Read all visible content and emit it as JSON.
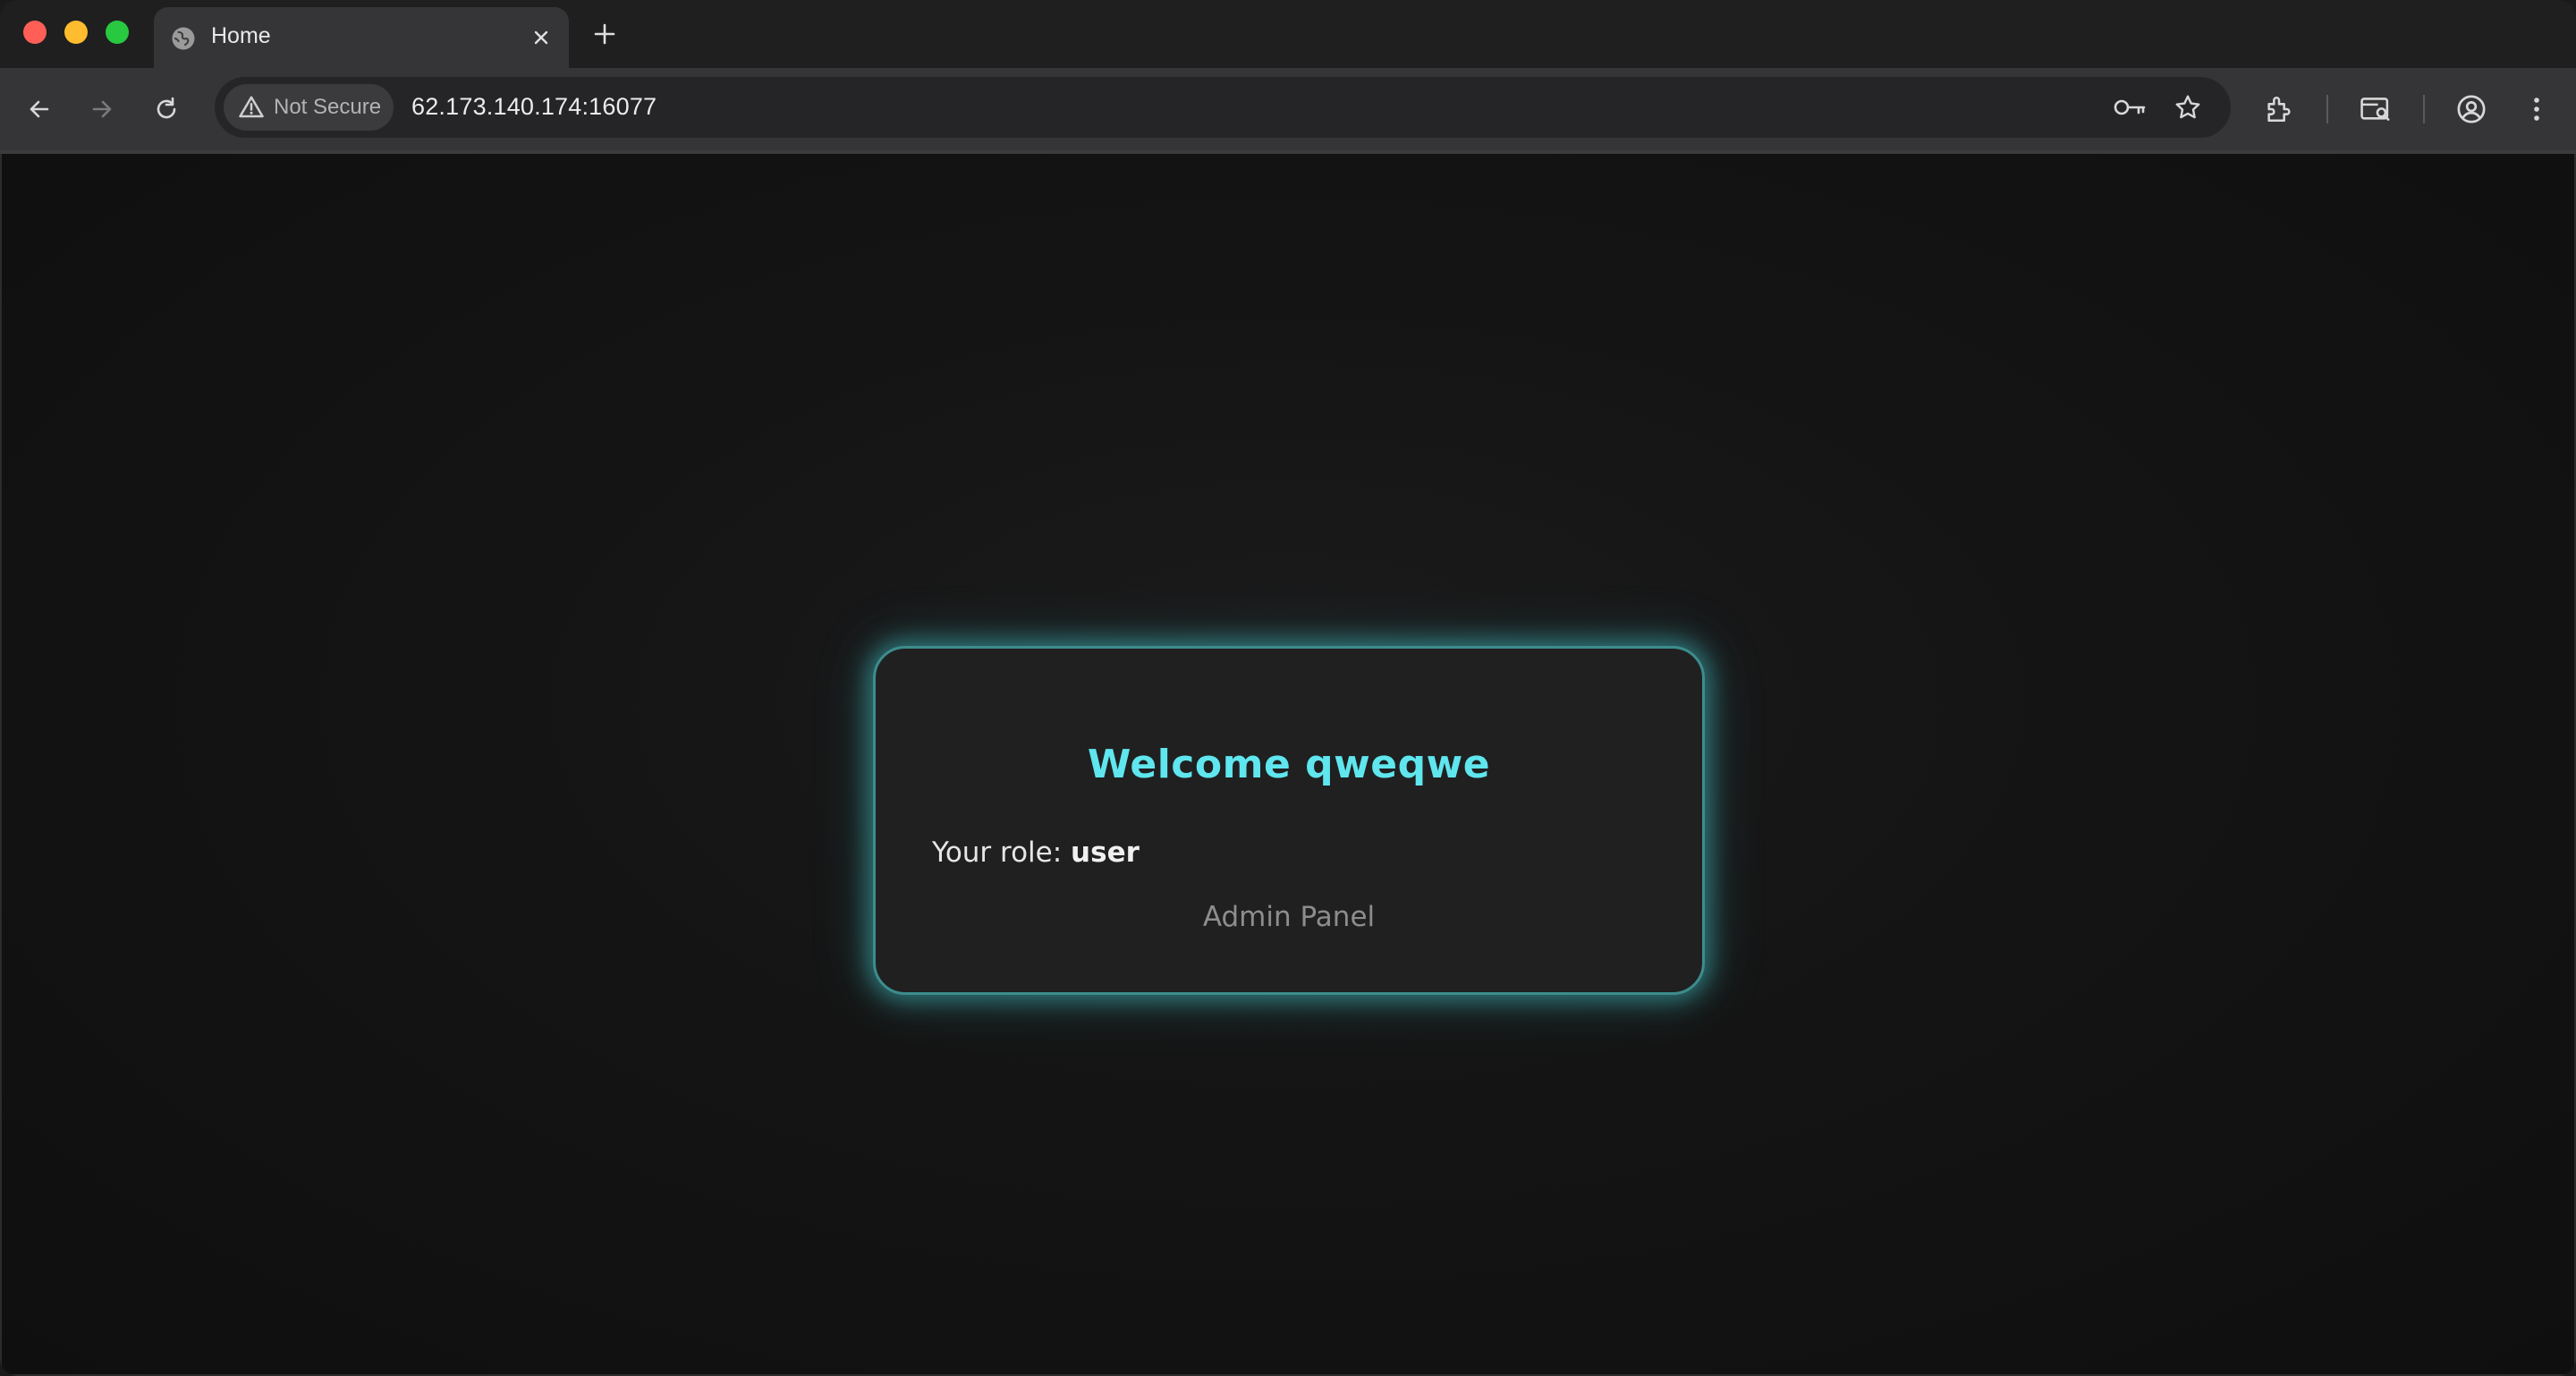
{
  "browser": {
    "tab": {
      "title": "Home",
      "favicon": "globe-icon"
    },
    "address": {
      "security_label": "Not Secure",
      "url": "62.173.140.174:16077"
    },
    "icons": [
      "back-arrow-icon",
      "forward-arrow-icon",
      "reload-icon",
      "key-icon",
      "star-icon",
      "extensions-icon",
      "tab-search-icon",
      "profile-icon",
      "menu-icon"
    ]
  },
  "page": {
    "card": {
      "title": "Welcome qweqwe",
      "role_prefix": "Your role: ",
      "role_value": "user",
      "admin_link": "Admin Panel",
      "accent_color": "#5fe6ee"
    }
  }
}
